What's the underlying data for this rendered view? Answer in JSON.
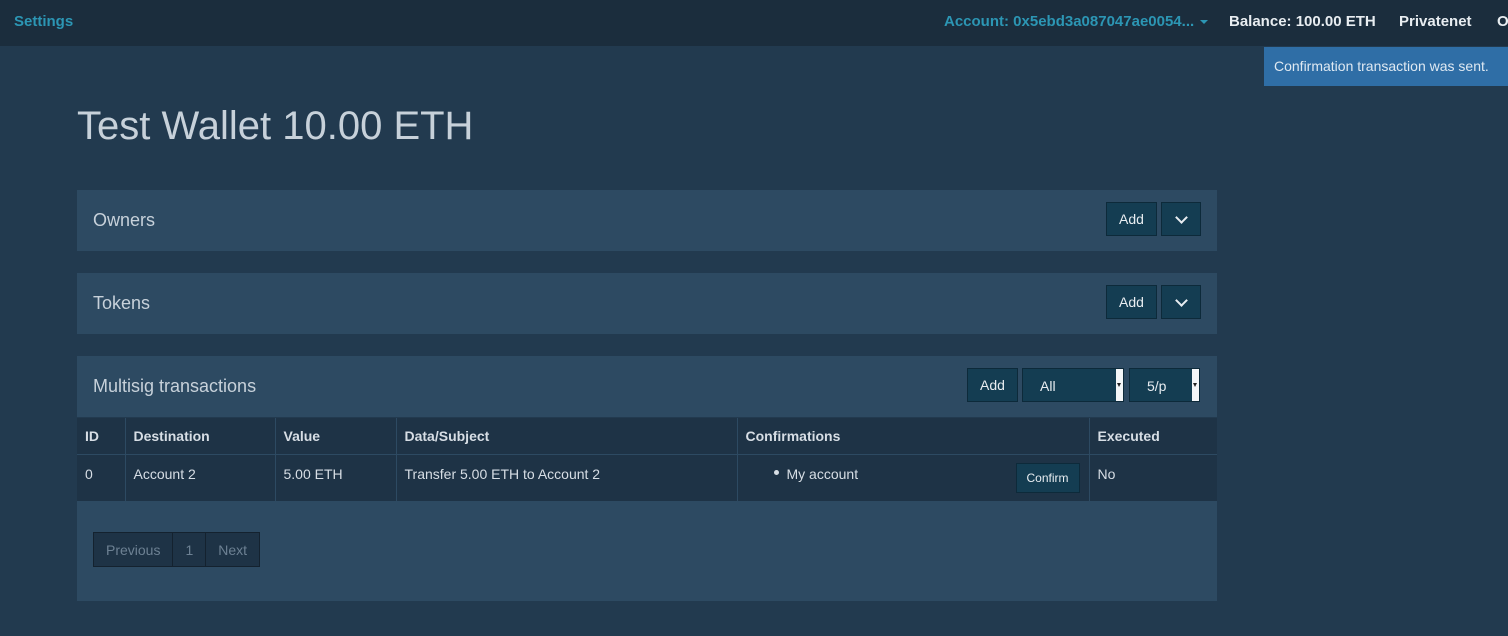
{
  "navbar": {
    "settings": "Settings",
    "account": "Account: 0x5ebd3a087047ae0054...",
    "balance": "Balance: 100.00 ETH",
    "network": "Privatenet",
    "extra": "O"
  },
  "notification": "Confirmation transaction was sent.",
  "page_title": "Test Wallet 10.00 ETH",
  "owners": {
    "title": "Owners",
    "add_label": "Add"
  },
  "tokens": {
    "title": "Tokens",
    "add_label": "Add"
  },
  "multisig": {
    "title": "Multisig transactions",
    "add_label": "Add",
    "filter_value": "All",
    "per_page_value": "5/p",
    "columns": [
      "ID",
      "Destination",
      "Value",
      "Data/Subject",
      "Confirmations",
      "Executed"
    ],
    "rows": [
      {
        "id": "0",
        "destination": "Account 2",
        "value": "5.00 ETH",
        "subject": "Transfer 5.00 ETH to Account 2",
        "confirmation": "My account",
        "confirm_label": "Confirm",
        "executed": "No"
      }
    ],
    "pagination": {
      "previous": "Previous",
      "page": "1",
      "next": "Next"
    }
  },
  "colors": {
    "background": "#223a4f",
    "navbar": "#1b2d3d",
    "accent": "#2c96b4",
    "notification": "#2f6ea6",
    "panel": "#2d4a62"
  }
}
